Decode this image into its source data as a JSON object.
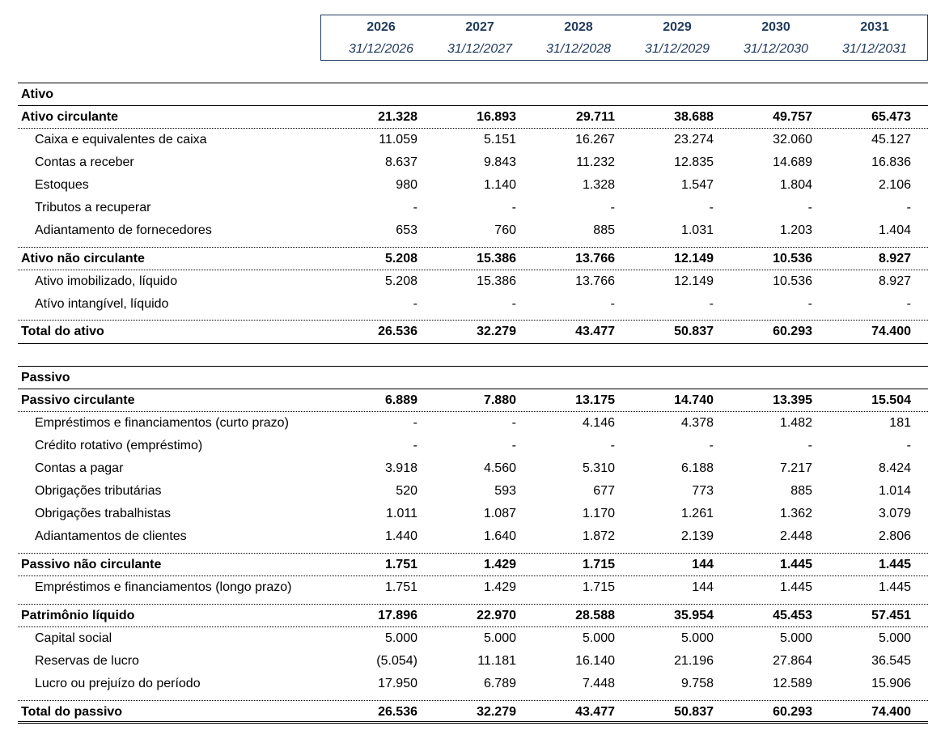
{
  "years": [
    "2026",
    "2027",
    "2028",
    "2029",
    "2030",
    "2031"
  ],
  "dates": [
    "31/12/2026",
    "31/12/2027",
    "31/12/2028",
    "31/12/2029",
    "31/12/2030",
    "31/12/2031"
  ],
  "rows": [
    {
      "label": "Ativo",
      "kind": "section",
      "values": []
    },
    {
      "label": "Ativo circulante",
      "kind": "bold",
      "values": [
        "21.328",
        "16.893",
        "29.711",
        "38.688",
        "49.757",
        "65.473"
      ]
    },
    {
      "label": "Caixa e equivalentes de caixa",
      "kind": "item",
      "values": [
        "11.059",
        "5.151",
        "16.267",
        "23.274",
        "32.060",
        "45.127"
      ]
    },
    {
      "label": "Contas a receber",
      "kind": "item",
      "values": [
        "8.637",
        "9.843",
        "11.232",
        "12.835",
        "14.689",
        "16.836"
      ]
    },
    {
      "label": "Estoques",
      "kind": "item",
      "values": [
        "980",
        "1.140",
        "1.328",
        "1.547",
        "1.804",
        "2.106"
      ]
    },
    {
      "label": "Tributos a recuperar",
      "kind": "item",
      "values": [
        "-",
        "-",
        "-",
        "-",
        "-",
        "-"
      ]
    },
    {
      "label": "Adiantamento de fornecedores",
      "kind": "item",
      "values": [
        "653",
        "760",
        "885",
        "1.031",
        "1.203",
        "1.404"
      ]
    },
    {
      "label": "Ativo não circulante",
      "kind": "bold",
      "values": [
        "5.208",
        "15.386",
        "13.766",
        "12.149",
        "10.536",
        "8.927"
      ]
    },
    {
      "label": "Ativo imobilizado, líquido",
      "kind": "item",
      "values": [
        "5.208",
        "15.386",
        "13.766",
        "12.149",
        "10.536",
        "8.927"
      ]
    },
    {
      "label": "Atívo intangível, líquido",
      "kind": "item",
      "values": [
        "-",
        "-",
        "-",
        "-",
        "-",
        "-"
      ]
    },
    {
      "label": "Total do ativo",
      "kind": "bold",
      "values": [
        "26.536",
        "32.279",
        "43.477",
        "50.837",
        "60.293",
        "74.400"
      ]
    },
    {
      "label": "Passivo",
      "kind": "section",
      "values": []
    },
    {
      "label": "Passivo circulante",
      "kind": "bold",
      "values": [
        "6.889",
        "7.880",
        "13.175",
        "14.740",
        "13.395",
        "15.504"
      ]
    },
    {
      "label": "Empréstimos e financiamentos (curto prazo)",
      "kind": "item",
      "values": [
        "-",
        "-",
        "4.146",
        "4.378",
        "1.482",
        "181"
      ]
    },
    {
      "label": "Crédito rotativo (empréstimo)",
      "kind": "item",
      "values": [
        "-",
        "-",
        "-",
        "-",
        "-",
        "-"
      ]
    },
    {
      "label": "Contas a pagar",
      "kind": "item",
      "values": [
        "3.918",
        "4.560",
        "5.310",
        "6.188",
        "7.217",
        "8.424"
      ]
    },
    {
      "label": "Obrigações tributárias",
      "kind": "item",
      "values": [
        "520",
        "593",
        "677",
        "773",
        "885",
        "1.014"
      ]
    },
    {
      "label": "Obrigações trabalhistas",
      "kind": "item",
      "values": [
        "1.011",
        "1.087",
        "1.170",
        "1.261",
        "1.362",
        "3.079"
      ]
    },
    {
      "label": "Adiantamentos de clientes",
      "kind": "item",
      "values": [
        "1.440",
        "1.640",
        "1.872",
        "2.139",
        "2.448",
        "2.806"
      ]
    },
    {
      "label": "Passivo não circulante",
      "kind": "bold",
      "values": [
        "1.751",
        "1.429",
        "1.715",
        "144",
        "1.445",
        "1.445"
      ]
    },
    {
      "label": "Empréstimos e financiamentos (longo prazo)",
      "kind": "item",
      "values": [
        "1.751",
        "1.429",
        "1.715",
        "144",
        "1.445",
        "1.445"
      ]
    },
    {
      "label": "Patrimônio líquido",
      "kind": "bold",
      "values": [
        "17.896",
        "22.970",
        "28.588",
        "35.954",
        "45.453",
        "57.451"
      ]
    },
    {
      "label": "Capital social",
      "kind": "item",
      "values": [
        "5.000",
        "5.000",
        "5.000",
        "5.000",
        "5.000",
        "5.000"
      ]
    },
    {
      "label": "Reservas de lucro",
      "kind": "item",
      "values": [
        "(5.054)",
        "11.181",
        "16.140",
        "21.196",
        "27.864",
        "36.545"
      ]
    },
    {
      "label": "Lucro ou prejuízo do período",
      "kind": "item",
      "values": [
        "17.950",
        "6.789",
        "7.448",
        "9.758",
        "12.589",
        "15.906"
      ]
    },
    {
      "label": "Total do passivo",
      "kind": "bold",
      "values": [
        "26.536",
        "32.279",
        "43.477",
        "50.837",
        "60.293",
        "74.400"
      ]
    }
  ]
}
